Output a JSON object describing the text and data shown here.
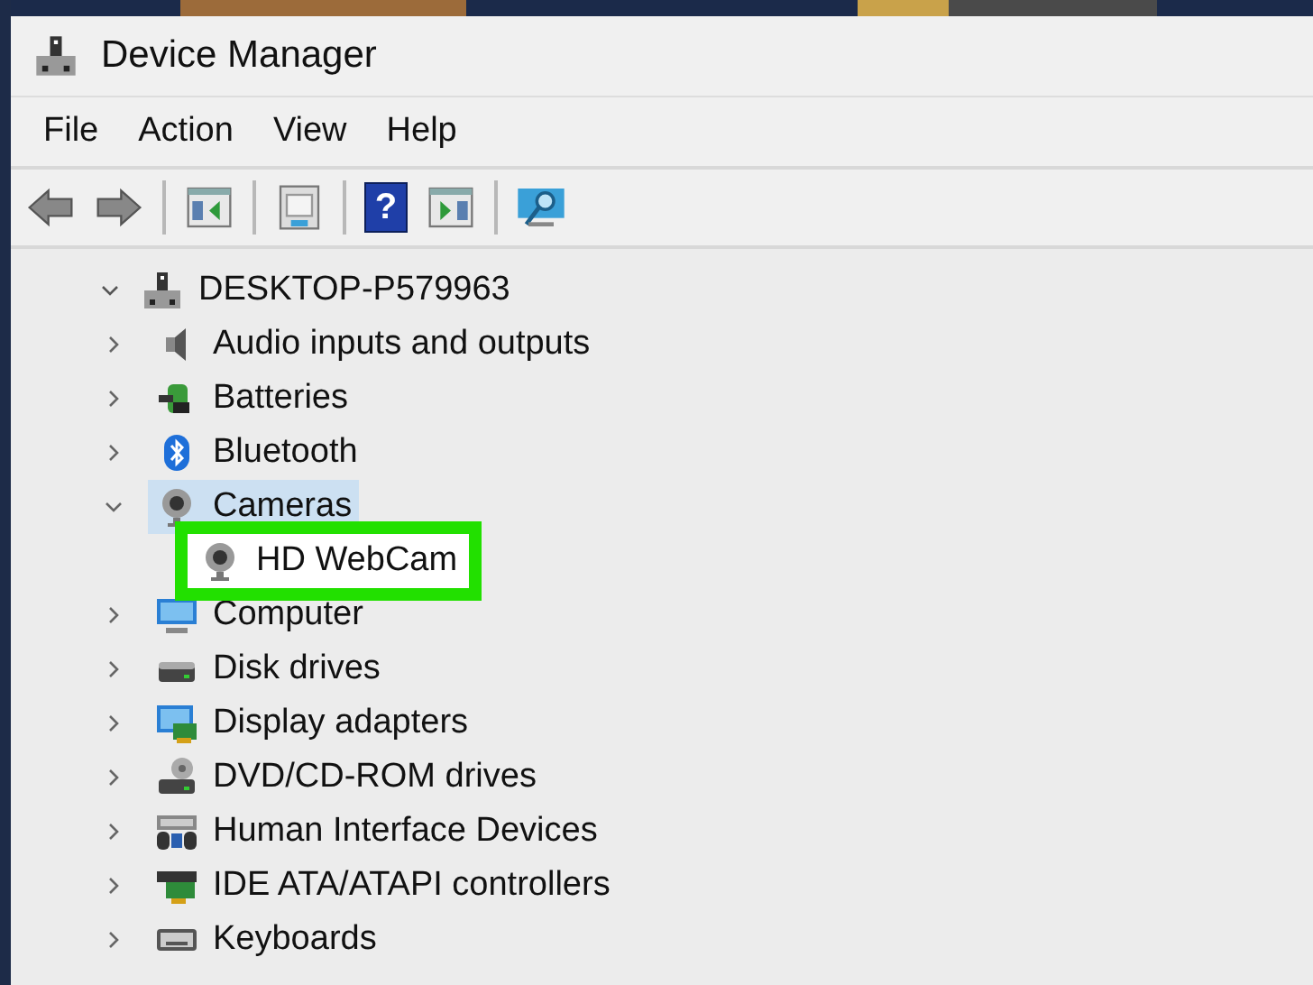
{
  "window": {
    "title": "Device Manager"
  },
  "menu": [
    {
      "label": "File"
    },
    {
      "label": "Action"
    },
    {
      "label": "View"
    },
    {
      "label": "Help"
    }
  ],
  "toolbar": [
    {
      "kind": "back"
    },
    {
      "kind": "forward"
    },
    {
      "kind": "separator"
    },
    {
      "kind": "tree-pane"
    },
    {
      "kind": "separator"
    },
    {
      "kind": "properties"
    },
    {
      "kind": "separator"
    },
    {
      "kind": "help",
      "label": "?"
    },
    {
      "kind": "action-pane"
    },
    {
      "kind": "separator"
    },
    {
      "kind": "scan"
    }
  ],
  "tree": {
    "label": "DESKTOP-P579963",
    "kind": "pc",
    "expanded": true,
    "selected": false,
    "children": [
      {
        "label": "Audio inputs and outputs",
        "kind": "audio",
        "expanded": false,
        "selected": false
      },
      {
        "label": "Batteries",
        "kind": "battery",
        "expanded": false,
        "selected": false
      },
      {
        "label": "Bluetooth",
        "kind": "bluetooth",
        "expanded": false,
        "selected": false
      },
      {
        "label": "Cameras",
        "kind": "camera",
        "expanded": true,
        "selected": true,
        "children": [
          {
            "label": "HD WebCam",
            "kind": "camera",
            "highlighted": true
          }
        ]
      },
      {
        "label": "Computer",
        "kind": "monitor",
        "expanded": false,
        "selected": false
      },
      {
        "label": "Disk drives",
        "kind": "disk",
        "expanded": false,
        "selected": false
      },
      {
        "label": "Display adapters",
        "kind": "display",
        "expanded": false,
        "selected": false
      },
      {
        "label": "DVD/CD-ROM drives",
        "kind": "dvd",
        "expanded": false,
        "selected": false
      },
      {
        "label": "Human Interface Devices",
        "kind": "hid",
        "expanded": false,
        "selected": false
      },
      {
        "label": "IDE ATA/ATAPI controllers",
        "kind": "ide",
        "expanded": false,
        "selected": false
      },
      {
        "label": "Keyboards",
        "kind": "keyboard",
        "expanded": false,
        "selected": false
      }
    ]
  }
}
